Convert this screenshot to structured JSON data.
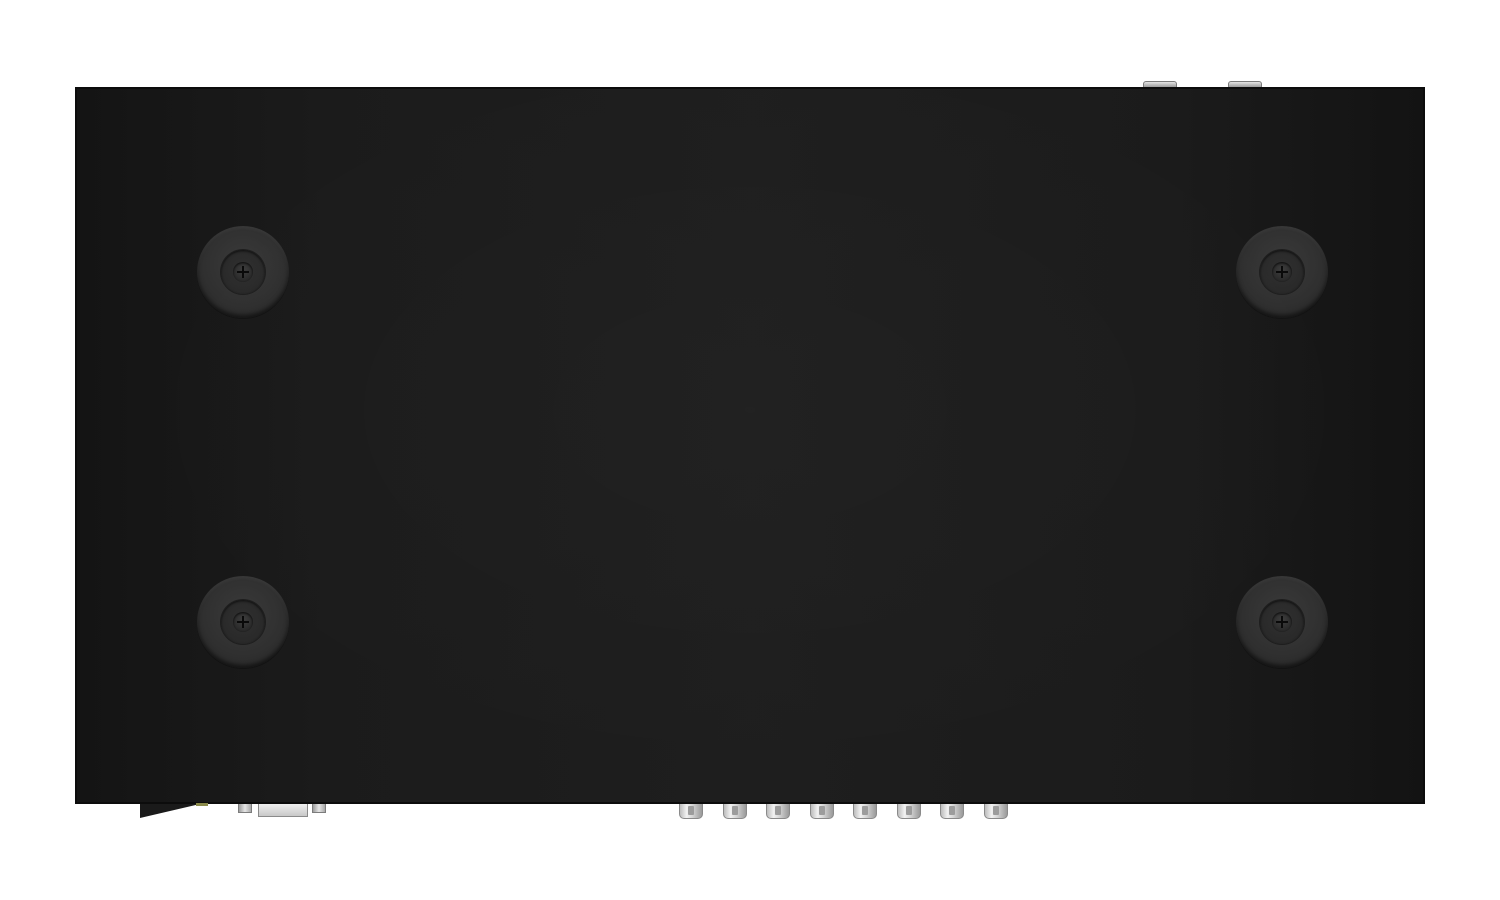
{
  "scene": {
    "subject": "device-bottom-view",
    "colors": {
      "background": "#ffffff",
      "chassis": "#1c1c1c",
      "rubber_feet": "#303030",
      "connector_metal": "#d0d0d0"
    },
    "rubber_feet": [
      {
        "name": "foot-top-left"
      },
      {
        "name": "foot-top-right"
      },
      {
        "name": "foot-bottom-left"
      },
      {
        "name": "foot-bottom-right"
      }
    ],
    "rca_connector_count": 8,
    "top_jack_count": 2
  }
}
